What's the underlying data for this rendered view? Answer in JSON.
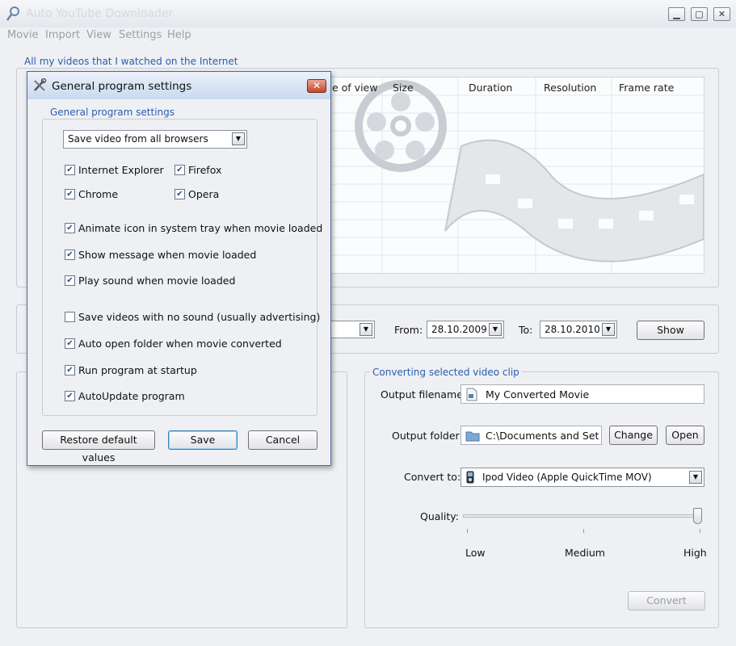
{
  "window": {
    "title": "Auto YouTube Downloader",
    "controls": {
      "minimize": "▁",
      "maximize": "▢",
      "close": "✕"
    }
  },
  "menu": [
    "Movie",
    "Import",
    "View",
    "Settings",
    "Help"
  ],
  "videos_group": {
    "title": "All my videos that I watched on the Internet",
    "columns": [
      "e of view",
      "Size",
      "Duration",
      "Resolution",
      "Frame rate"
    ]
  },
  "filter": {
    "from_label": "From:",
    "from_value": "28.10.2009",
    "to_label": "To:",
    "to_value": "28.10.2010",
    "show_button": "Show"
  },
  "convert_group": {
    "title": "Converting selected video clip",
    "output_filename_label": "Output filename:",
    "output_filename_value": "My Converted Movie",
    "output_folder_label": "Output folder:",
    "output_folder_value": "C:\\Documents and Settir",
    "change_button": "Change",
    "open_button": "Open",
    "convert_to_label": "Convert to:",
    "convert_to_value": "Ipod Video (Apple QuickTime MOV)",
    "quality_label": "Quality:",
    "quality_level": 1.0,
    "quality_marks": [
      "Low",
      "Medium",
      "High"
    ],
    "convert_button": "Convert"
  },
  "dialog": {
    "title": "General program settings",
    "close": "✕",
    "group_title": "General program settings",
    "browser_select": "Save video from all browsers",
    "browsers": [
      {
        "label": "Internet Explorer",
        "checked": true
      },
      {
        "label": "Firefox",
        "checked": true
      },
      {
        "label": "Chrome",
        "checked": true
      },
      {
        "label": "Opera",
        "checked": true
      }
    ],
    "options": [
      {
        "label": "Animate icon in system tray when movie loaded",
        "checked": true
      },
      {
        "label": "Show message when movie loaded",
        "checked": true
      },
      {
        "label": "Play sound when movie loaded",
        "checked": true
      },
      {
        "label": "Save videos with no sound (usually advertising)",
        "checked": false
      },
      {
        "label": "Auto open folder when movie converted",
        "checked": true
      },
      {
        "label": "Run program at startup",
        "checked": true
      },
      {
        "label": "AutoUpdate program",
        "checked": true
      }
    ],
    "restore_button": "Restore default values",
    "save_button": "Save",
    "cancel_button": "Cancel"
  },
  "colors": {
    "accent": "#2a5db0",
    "titlebar_text": "#d5d9df"
  }
}
